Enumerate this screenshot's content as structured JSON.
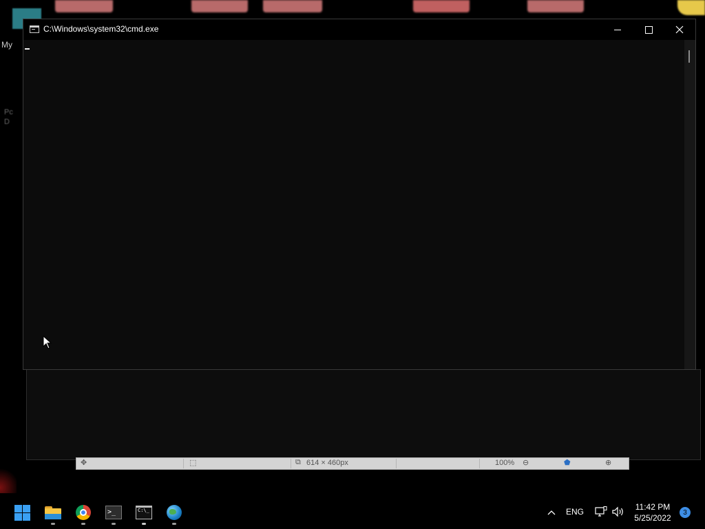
{
  "desktop": {
    "side_text": "My",
    "side_label_a": "Pc",
    "side_label_b": "D"
  },
  "under_window": {
    "statusbar": {
      "dimensions": "614 × 460px",
      "zoom": "100%"
    }
  },
  "cmd_window": {
    "title": "C:\\Windows\\system32\\cmd.exe",
    "icon": "cmd-icon",
    "controls": {
      "minimize": "minimize-icon",
      "maximize": "maximize-icon",
      "close": "close-icon"
    },
    "console_text": ""
  },
  "taskbar": {
    "apps": [
      {
        "name": "Start",
        "icon": "windows-logo-icon",
        "running": false
      },
      {
        "name": "File Explorer",
        "icon": "folder-icon",
        "running": true
      },
      {
        "name": "Google Chrome",
        "icon": "chrome-icon",
        "running": true
      },
      {
        "name": "Terminal",
        "icon": "terminal-icon",
        "running": true
      },
      {
        "name": "Command Prompt",
        "icon": "cmd-icon",
        "running": true
      },
      {
        "name": "Browser",
        "icon": "globe-icon",
        "running": true
      }
    ],
    "tray": {
      "language": "ENG",
      "time": "11:42 PM",
      "date": "5/25/2022",
      "notification_count": "3"
    }
  },
  "colors": {
    "console_bg": "#0c0c0c",
    "accent": "#3aa0f3",
    "badge": "#3d8ee6"
  }
}
